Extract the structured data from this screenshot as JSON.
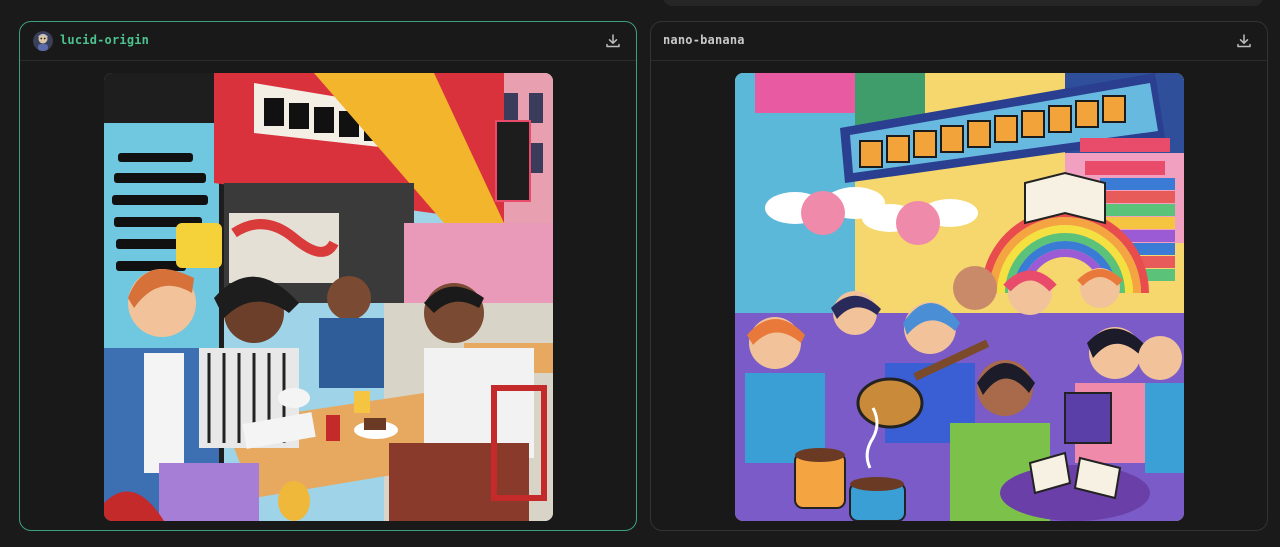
{
  "panels": [
    {
      "model_name": "lucid-origin",
      "selected": true,
      "avatar_icon": "robot-portrait-icon",
      "download_icon": "download-icon"
    },
    {
      "model_name": "nano-banana",
      "selected": false,
      "download_icon": "download-icon"
    }
  ],
  "colors": {
    "selected_border": "#3fa07b",
    "selected_name": "#4cc28f",
    "background": "#1a1a1a"
  }
}
